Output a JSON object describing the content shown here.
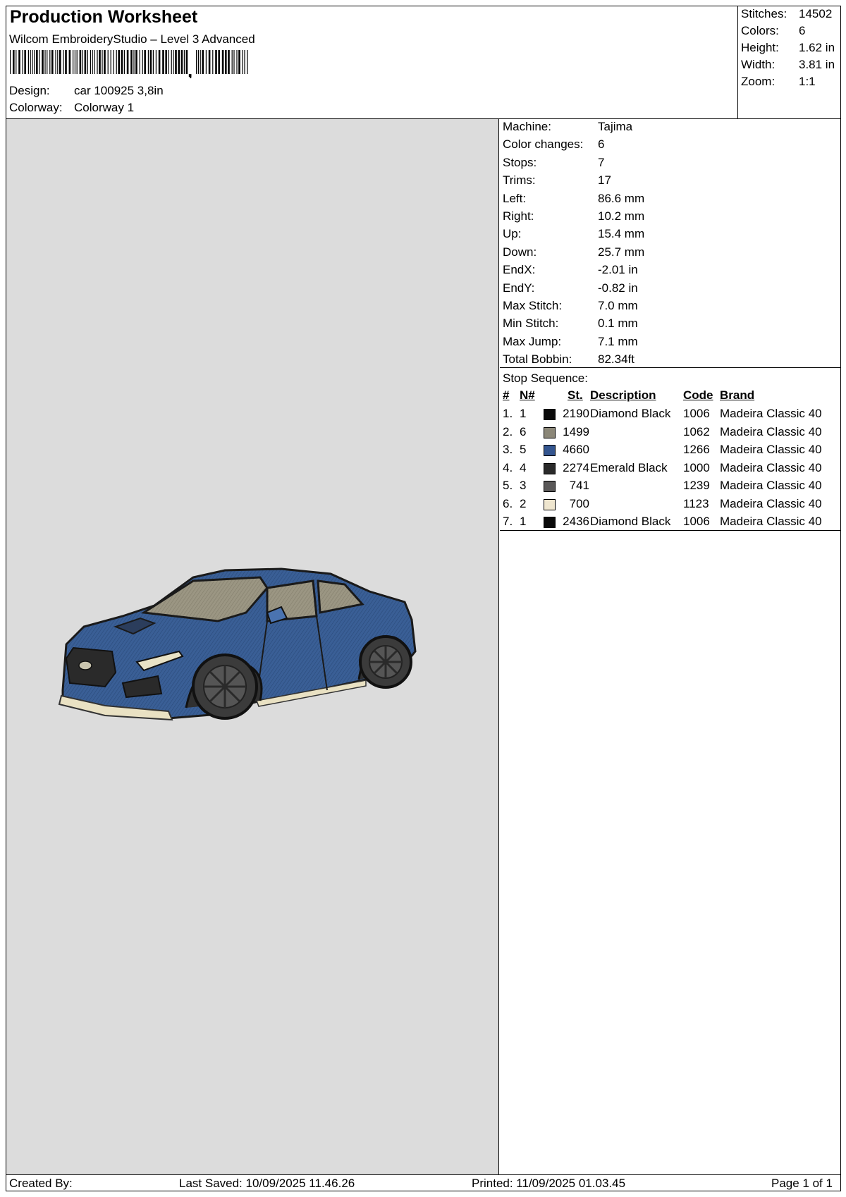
{
  "header": {
    "title": "Production Worksheet",
    "software": "Wilcom EmbroideryStudio – Level 3 Advanced",
    "design_label": "Design:",
    "design_value": "car 100925 3,8in",
    "colorway_label": "Colorway:",
    "colorway_value": "Colorway 1"
  },
  "stats": [
    {
      "label": "Stitches:",
      "value": "14502"
    },
    {
      "label": "Colors:",
      "value": "6"
    },
    {
      "label": "Height:",
      "value": "1.62 in"
    },
    {
      "label": "Width:",
      "value": "3.81 in"
    },
    {
      "label": "Zoom:",
      "value": "1:1"
    }
  ],
  "machine_info": [
    {
      "label": "Machine:",
      "value": "Tajima"
    },
    {
      "label": "Color changes:",
      "value": "6"
    },
    {
      "label": "Stops:",
      "value": "7"
    },
    {
      "label": "Trims:",
      "value": "17"
    },
    {
      "label": "Left:",
      "value": "86.6 mm"
    },
    {
      "label": "Right:",
      "value": "10.2 mm"
    },
    {
      "label": "Up:",
      "value": "15.4 mm"
    },
    {
      "label": "Down:",
      "value": "25.7 mm"
    },
    {
      "label": "EndX:",
      "value": "-2.01 in"
    },
    {
      "label": "EndY:",
      "value": "-0.82 in"
    },
    {
      "label": "Max Stitch:",
      "value": "7.0 mm"
    },
    {
      "label": "Min Stitch:",
      "value": "0.1 mm"
    },
    {
      "label": "Max Jump:",
      "value": "7.1 mm"
    },
    {
      "label": "Total Bobbin:",
      "value": "82.34ft"
    }
  ],
  "stop_sequence": {
    "title": "Stop Sequence:",
    "headers": {
      "num": "#",
      "n": "N#",
      "st": "St.",
      "description": "Description",
      "code": "Code",
      "brand": "Brand"
    },
    "rows": [
      {
        "num": "1.",
        "n": "1",
        "color": "#0a0a0a",
        "st": "2190",
        "description": "Diamond Black",
        "code": "1006",
        "brand": "Madeira Classic 40"
      },
      {
        "num": "2.",
        "n": "6",
        "color": "#8b8778",
        "st": "1499",
        "description": "",
        "code": "1062",
        "brand": "Madeira Classic 40"
      },
      {
        "num": "3.",
        "n": "5",
        "color": "#34558f",
        "st": "4660",
        "description": "",
        "code": "1266",
        "brand": "Madeira Classic 40"
      },
      {
        "num": "4.",
        "n": "4",
        "color": "#2a2a2a",
        "st": "2274",
        "description": "Emerald Black",
        "code": "1000",
        "brand": "Madeira Classic 40"
      },
      {
        "num": "5.",
        "n": "3",
        "color": "#5a5858",
        "st": "741",
        "description": "",
        "code": "1239",
        "brand": "Madeira Classic 40"
      },
      {
        "num": "6.",
        "n": "2",
        "color": "#efe6cf",
        "st": "700",
        "description": "",
        "code": "1123",
        "brand": "Madeira Classic 40"
      },
      {
        "num": "7.",
        "n": "1",
        "color": "#0a0a0a",
        "st": "2436",
        "description": "Diamond Black",
        "code": "1006",
        "brand": "Madeira Classic 40"
      }
    ]
  },
  "footer": {
    "created": "Created By:",
    "last_saved": "Last Saved: 10/09/2025 11.46.26",
    "printed": "Printed: 11/09/2025 01.03.45",
    "page": "Page 1 of 1"
  }
}
